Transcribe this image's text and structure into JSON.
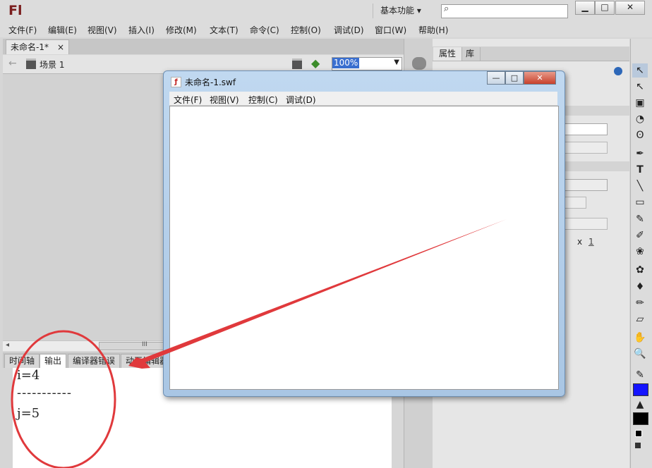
{
  "app": {
    "logo": "Fl",
    "workspace": "基本功能",
    "workspace_arrow": "▾",
    "search_icon": "⌕",
    "window_controls": [
      "▁",
      "□",
      "✕"
    ]
  },
  "menubar": [
    "文件(F)",
    "编辑(E)",
    "视图(V)",
    "插入(I)",
    "修改(M)",
    "文本(T)",
    "命令(C)",
    "控制(O)",
    "调试(D)",
    "窗口(W)",
    "帮助(H)"
  ],
  "document": {
    "tab_label": "未命名-1*",
    "tab_close": "×",
    "back_arrow": "←",
    "scene_label": "场景 1",
    "zoom": "100%",
    "scroll_grip": "III"
  },
  "bottom_panel": {
    "tabs": [
      "时间轴",
      "输出",
      "编译器错误",
      "动画编辑器"
    ],
    "active_tab": "输出",
    "output_lines": [
      "i=4",
      "-----------",
      "j=5"
    ]
  },
  "right_panel": {
    "tabs": [
      "属性",
      "库"
    ],
    "field_x_label": "x",
    "field_value": "1"
  },
  "tools": [
    "↖",
    "↖",
    "▣",
    "◔",
    "ʘ",
    "✒",
    "T",
    "╲",
    "▭",
    "✎",
    "✐",
    "❀",
    "✿",
    "♦",
    "✏",
    "▱",
    "✋",
    "🔍",
    "✎",
    "■",
    "▲",
    "■"
  ],
  "swf_window": {
    "title": "未命名-1.swf",
    "controls": [
      "—",
      "□",
      "✕"
    ],
    "menus": [
      "文件(F)",
      "视图(V)",
      "控制(C)",
      "调试(D)"
    ]
  },
  "colors": {
    "annotation": "#e0393c",
    "stroke_swatch": "#1414ff",
    "fill_swatch": "#000000",
    "logo": "#7a1d1d"
  }
}
